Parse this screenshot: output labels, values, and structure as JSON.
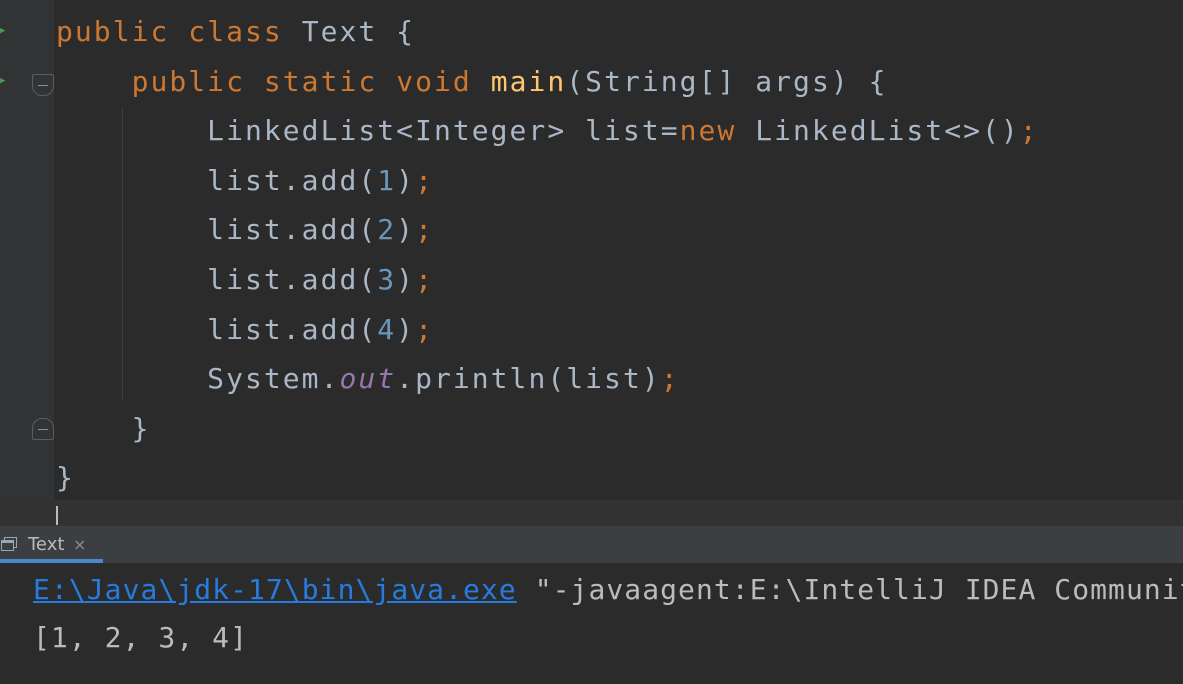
{
  "colors": {
    "background": "#2b2b2b",
    "keyword": "#cc7832",
    "method": "#ffc66d",
    "number": "#6897bb",
    "static_field": "#9876aa",
    "plain": "#a9b7c6",
    "console_link": "#287bde",
    "tab_underline": "#4a88c7"
  },
  "editor": {
    "lines": [
      [
        {
          "text": "public",
          "cls": "kw"
        },
        {
          "text": " "
        },
        {
          "text": "class",
          "cls": "kw"
        },
        {
          "text": " Text {"
        }
      ],
      [
        {
          "text": "    "
        },
        {
          "text": "public",
          "cls": "kw"
        },
        {
          "text": " "
        },
        {
          "text": "static",
          "cls": "kw"
        },
        {
          "text": " "
        },
        {
          "text": "void",
          "cls": "kw"
        },
        {
          "text": " "
        },
        {
          "text": "main",
          "cls": "fn"
        },
        {
          "text": "(String[] args) {"
        }
      ],
      [
        {
          "text": "        LinkedList<Integer> list="
        },
        {
          "text": "new",
          "cls": "kw"
        },
        {
          "text": " LinkedList<>()"
        },
        {
          "text": ";",
          "cls": "kw"
        }
      ],
      [
        {
          "text": "        list.add("
        },
        {
          "text": "1",
          "cls": "num"
        },
        {
          "text": ")"
        },
        {
          "text": ";",
          "cls": "kw"
        }
      ],
      [
        {
          "text": "        list.add("
        },
        {
          "text": "2",
          "cls": "num"
        },
        {
          "text": ")"
        },
        {
          "text": ";",
          "cls": "kw"
        }
      ],
      [
        {
          "text": "        list.add("
        },
        {
          "text": "3",
          "cls": "num"
        },
        {
          "text": ")"
        },
        {
          "text": ";",
          "cls": "kw"
        }
      ],
      [
        {
          "text": "        list.add("
        },
        {
          "text": "4",
          "cls": "num"
        },
        {
          "text": ")"
        },
        {
          "text": ";",
          "cls": "kw"
        }
      ],
      [
        {
          "text": "        System."
        },
        {
          "text": "out",
          "cls": "fld"
        },
        {
          "text": ".println(list)"
        },
        {
          "text": ";",
          "cls": "kw"
        }
      ],
      [
        {
          "text": "    }"
        }
      ],
      [
        {
          "text": "}"
        }
      ]
    ]
  },
  "run_panel": {
    "tab_label": "Text",
    "tab_close": "×",
    "console": {
      "command_link": "E:\\Java\\jdk-17\\bin\\java.exe",
      "command_rest": " \"-javaagent:E:\\IntelliJ IDEA Community E",
      "output": "[1, 2, 3, 4]"
    }
  },
  "icons": {
    "run_gutter": "run-arrow-icon",
    "fold_open": "fold-open-icon",
    "fold_close": "fold-close-icon",
    "console_tab": "console-window-icon",
    "close": "close-icon"
  }
}
